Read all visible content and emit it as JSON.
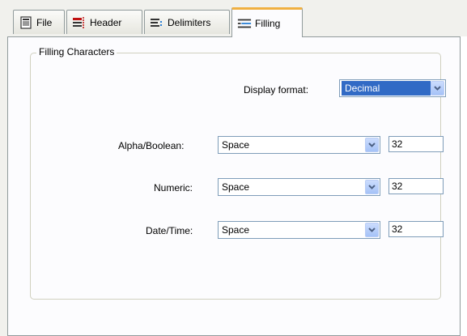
{
  "tabs": [
    {
      "label": "File",
      "icon": "file-icon"
    },
    {
      "label": "Header",
      "icon": "header-icon"
    },
    {
      "label": "Delimiters",
      "icon": "delimiters-icon"
    },
    {
      "label": "Filling",
      "icon": "filling-icon",
      "active": true
    }
  ],
  "group": {
    "title": "Filling Characters"
  },
  "display_format": {
    "label": "Display format:",
    "value": "Decimal"
  },
  "rows": [
    {
      "label": "Alpha/Boolean:",
      "value": "Space",
      "code": "32"
    },
    {
      "label": "Numeric:",
      "value": "Space",
      "code": "32"
    },
    {
      "label": "Date/Time:",
      "value": "Space",
      "code": "32"
    }
  ],
  "colors": {
    "accent_tab": "#f0b040",
    "selection": "#316ac5",
    "border": "#919b9c"
  }
}
